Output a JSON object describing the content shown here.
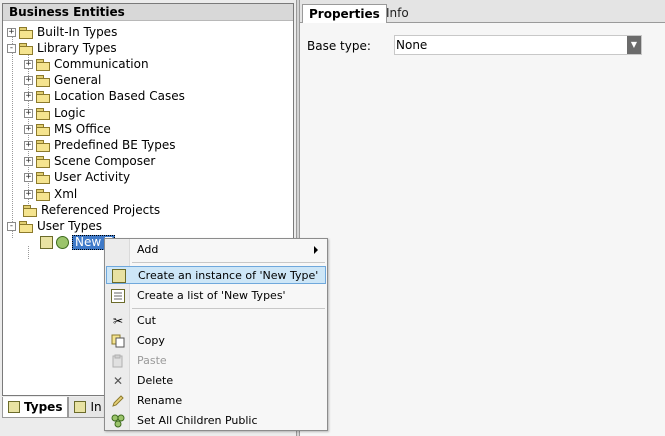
{
  "left_panel": {
    "title": "Business Entities",
    "tree": [
      {
        "label": "Built-In Types",
        "expander": "+"
      },
      {
        "label": "Library Types",
        "expander": "-"
      },
      {
        "label": "Communication",
        "expander": "+"
      },
      {
        "label": "General",
        "expander": "+"
      },
      {
        "label": "Location Based Cases",
        "expander": "+"
      },
      {
        "label": "Logic",
        "expander": "+"
      },
      {
        "label": "MS Office",
        "expander": "+"
      },
      {
        "label": "Predefined BE Types",
        "expander": "+"
      },
      {
        "label": "Scene Composer",
        "expander": "+"
      },
      {
        "label": "User Activity",
        "expander": "+"
      },
      {
        "label": "Xml",
        "expander": "+"
      },
      {
        "label": "Referenced Projects",
        "expander": ""
      },
      {
        "label": "User Types",
        "expander": "-"
      }
    ],
    "selected_node": "New T",
    "bottom_tabs": {
      "types": "Types",
      "instances": "In"
    }
  },
  "right_panel": {
    "tabs": {
      "properties": "Properties",
      "info": "Info"
    },
    "base_type_label": "Base type:",
    "base_type_value": "None",
    "dropdown_arrow": "▼"
  },
  "context_menu": {
    "items": [
      {
        "label": "Add",
        "icon": "none",
        "submenu": true
      },
      {
        "label": "Create an instance of 'New Type'",
        "icon": "create-instance-icon"
      },
      {
        "label": "Create a list of 'New Types'",
        "icon": "create-list-icon"
      },
      {
        "label": "Cut",
        "icon": "scissors-icon"
      },
      {
        "label": "Copy",
        "icon": "copy-icon"
      },
      {
        "label": "Paste",
        "icon": "paste-icon"
      },
      {
        "label": "Delete",
        "icon": "delete-icon"
      },
      {
        "label": "Rename",
        "icon": "rename-icon"
      },
      {
        "label": "Set All Children Public",
        "icon": "group-icon"
      }
    ]
  },
  "colors": {
    "selection": "#3f7ac9",
    "menu_highlight": "#cde6f7",
    "folder": "#f5e48f"
  }
}
